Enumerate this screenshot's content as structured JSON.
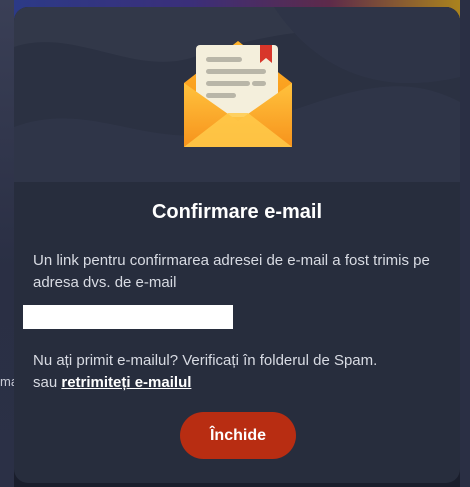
{
  "background": {
    "left_text": "ma"
  },
  "modal": {
    "icon": "open-envelope-letter-icon",
    "title": "Confirmare e-mail",
    "message": "Un link pentru confirmarea adresei de e-mail a fost trimis pe adresa dvs. de e-mail",
    "email_redacted": true,
    "spam_hint": "Nu ați primit e-mailul? Verificați în folderul de Spam.",
    "resend_prefix": "sau",
    "resend_link": "retrimiteți e-mailul",
    "close_label": "Închide"
  },
  "colors": {
    "modal_bg": "#272d3d",
    "accent_button": "#b82d12",
    "envelope_orange": "#f5a623",
    "text": "#d8dbe3"
  }
}
